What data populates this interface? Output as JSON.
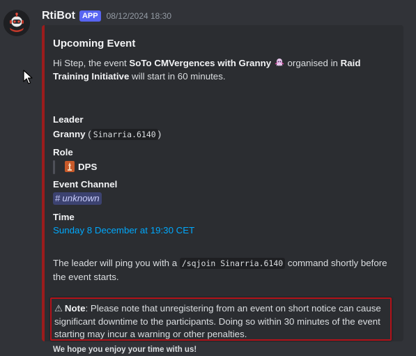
{
  "message": {
    "bot_name": "RtiBot",
    "app_badge": "APP",
    "timestamp": "08/12/2024 18:30"
  },
  "embed": {
    "accent_color": "#9b1c1c",
    "title": "Upcoming Event",
    "intro": {
      "prefix": "Hi Step, the event ",
      "event_name": "SoTo CMVergences with Granny",
      "middle": " organised in ",
      "organisation": "Raid Training Initiative",
      "suffix": " will start in 60 minutes."
    },
    "leader": {
      "label": "Leader",
      "name": "Granny",
      "open_paren": " (",
      "account": "Sinarria.6140",
      "close_paren": ")"
    },
    "role": {
      "label": "Role",
      "value": "DPS"
    },
    "channel": {
      "label": "Event Channel",
      "hash": "#",
      "value": "unknown"
    },
    "time": {
      "label": "Time",
      "value": "Sunday 8 December at 19:30 CET"
    },
    "ping": {
      "prefix": "The leader will ping you with a ",
      "command": "/sqjoin Sinarria.6140",
      "suffix": " command shortly before the event starts."
    },
    "note": {
      "icon": "⚠",
      "label": "Note",
      "text": ": Please note that unregistering from an event on short notice can cause significant downtime to the participants. Doing so within 30 minutes of the event starting may incur a warning or other penalties."
    },
    "footer": "We hope you enjoy your time with us!"
  }
}
